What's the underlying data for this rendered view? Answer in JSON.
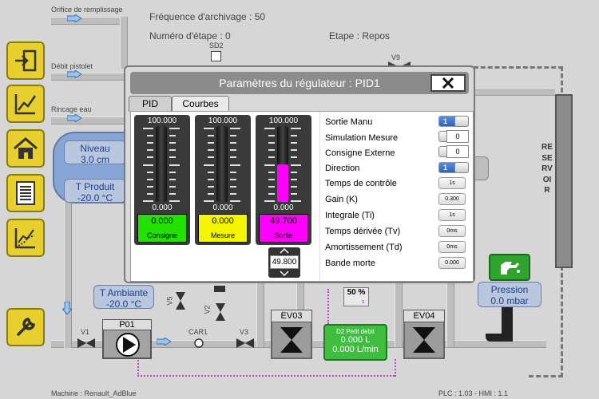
{
  "header": {
    "freq_label": "Fréquence d'archivage : 50",
    "step_num_label": "Numéro d'étape : 0",
    "step_label": "Etape : Repos"
  },
  "inputs": {
    "orifice": "Orifice de remplissage",
    "pistolet": "Débit pistolet",
    "rincage": "Rincage eau"
  },
  "tank": {
    "niveau_label": "Niveau",
    "niveau_value": "3.0 cm",
    "temp_label": "T Produit",
    "temp_value": "-20.0 °C"
  },
  "ambient": {
    "label": "T Ambiante",
    "value": "-20.0 °C"
  },
  "pressure": {
    "label": "Pression",
    "value": "0.0 mbar"
  },
  "reservoir": "RESERVOIR",
  "equipment": {
    "sd2": "SD2",
    "v9": "V9",
    "v1": "V1",
    "p01": "P01",
    "car1": "CAR1",
    "v3": "V3",
    "v5": "V5",
    "v2": "V2",
    "ev03": "EV03",
    "ev04": "EV04",
    "pct": "50 %",
    "pct_unit": "s"
  },
  "flow": {
    "label": "D2 Petit debit",
    "volume": "0.000 L",
    "rate": "0.000 L/min"
  },
  "footer": {
    "machine": "Machine : Renault_AdBlue",
    "version": "PLC : 1.03 - HMI : 1.1"
  },
  "modal": {
    "title": "Paramètres du régulateur : PID1",
    "tabs": [
      "PID",
      "Courbes"
    ],
    "gauges": [
      {
        "max": "100.000",
        "min": "0.000",
        "value": "0.000",
        "name": "Consigne",
        "level": 0.0,
        "color": "#22e000"
      },
      {
        "max": "100.000",
        "min": "0.000",
        "value": "0.000",
        "name": "Mesure",
        "level": 0.0,
        "color": "#f5f500"
      },
      {
        "max": "100.000",
        "min": "0.000",
        "value": "49.700",
        "name": "Sortie",
        "level": 0.497,
        "color": "#ff00ff"
      }
    ],
    "stepper_value": "49.800",
    "params": [
      {
        "label": "Sortie Manu",
        "kind": "toggle",
        "state": "on",
        "num": "1"
      },
      {
        "label": "Simulation Mesure",
        "kind": "toggle",
        "state": "off",
        "num": "0"
      },
      {
        "label": "Consigne Externe",
        "kind": "toggle",
        "state": "off",
        "num": "0"
      },
      {
        "label": "Direction",
        "kind": "toggle",
        "state": "on",
        "num": "1"
      },
      {
        "label": "Temps de contrôle",
        "kind": "value",
        "value": "1s"
      },
      {
        "label": "Gain (K)",
        "kind": "value",
        "value": "0.300"
      },
      {
        "label": "Integrale (Ti)",
        "kind": "value",
        "value": "1s"
      },
      {
        "label": "Temps dérivée (Tv)",
        "kind": "value",
        "value": "0ms"
      },
      {
        "label": "Amortissement (Td)",
        "kind": "value",
        "value": "0ms"
      },
      {
        "label": "Bande morte",
        "kind": "value",
        "value": "0.000"
      }
    ]
  }
}
